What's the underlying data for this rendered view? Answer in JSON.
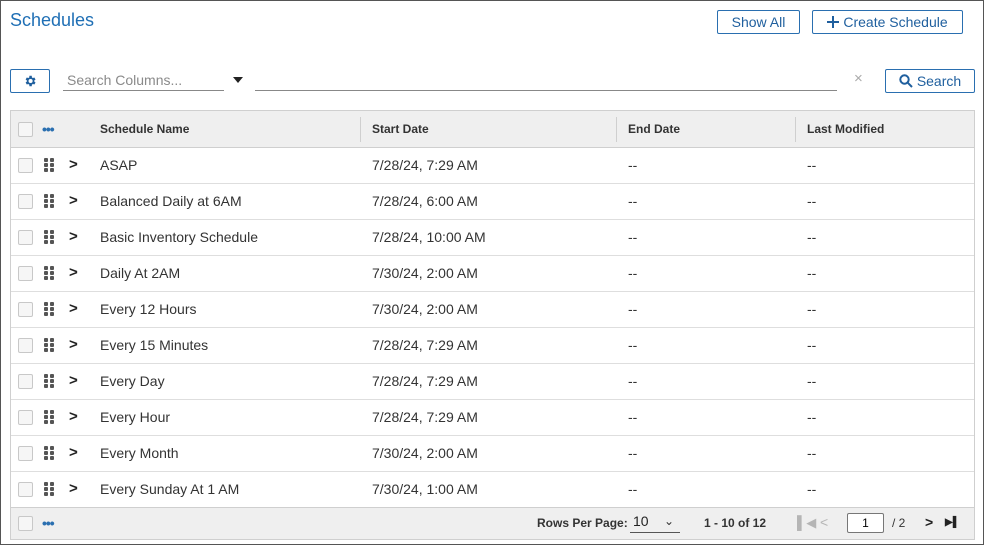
{
  "header": {
    "title": "Schedules",
    "show_all_label": "Show All",
    "create_label": "Create Schedule",
    "create_icon": "plus-icon"
  },
  "toolbar": {
    "settings_icon": "gear-icon",
    "search_placeholder": "Search Columns...",
    "search_value": "",
    "clear_symbol": "×",
    "search_label": "Search",
    "search_icon": "magnifier-icon"
  },
  "table": {
    "columns": [
      "Schedule Name",
      "Start Date",
      "End Date",
      "Last Modified"
    ],
    "more_symbol": "•••",
    "rows": [
      {
        "name": "ASAP",
        "start": "7/28/24, 7:29 AM",
        "end": "--",
        "modified": "--"
      },
      {
        "name": "Balanced Daily at 6AM",
        "start": "7/28/24, 6:00 AM",
        "end": "--",
        "modified": "--"
      },
      {
        "name": "Basic Inventory Schedule",
        "start": "7/28/24, 10:00 AM",
        "end": "--",
        "modified": "--"
      },
      {
        "name": "Daily At 2AM",
        "start": "7/30/24, 2:00 AM",
        "end": "--",
        "modified": "--"
      },
      {
        "name": "Every 12 Hours",
        "start": "7/30/24, 2:00 AM",
        "end": "--",
        "modified": "--"
      },
      {
        "name": "Every 15 Minutes",
        "start": "7/28/24, 7:29 AM",
        "end": "--",
        "modified": "--"
      },
      {
        "name": "Every Day",
        "start": "7/28/24, 7:29 AM",
        "end": "--",
        "modified": "--"
      },
      {
        "name": "Every Hour",
        "start": "7/28/24, 7:29 AM",
        "end": "--",
        "modified": "--"
      },
      {
        "name": "Every Month",
        "start": "7/30/24, 2:00 AM",
        "end": "--",
        "modified": "--"
      },
      {
        "name": "Every Sunday At 1 AM",
        "start": "7/30/24, 1:00 AM",
        "end": "--",
        "modified": "--"
      }
    ]
  },
  "pagination": {
    "rows_per_page_label": "Rows Per Page:",
    "rows_per_page_value": "10",
    "range_text": "1 - 10 of 12",
    "current_page": "1",
    "total_pages_text": "/ 2"
  },
  "colors": {
    "accent": "#1f6fb5",
    "header_bg": "#efefef",
    "border": "#cfcfcf"
  }
}
